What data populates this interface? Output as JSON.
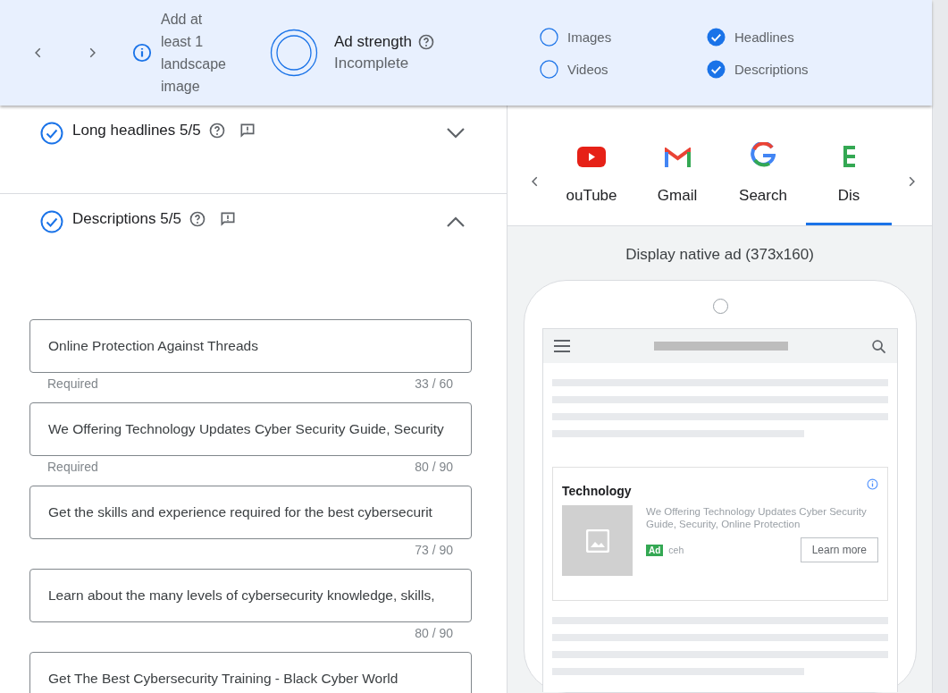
{
  "banner": {
    "tip": "Add at least 1 landscape image",
    "strength_label": "Ad strength",
    "strength_value": "Incomplete",
    "checklist": [
      {
        "label": "Images",
        "checked": false
      },
      {
        "label": "Videos",
        "checked": false
      },
      {
        "label": "Headlines",
        "checked": true
      },
      {
        "label": "Descriptions",
        "checked": true
      }
    ]
  },
  "sections": [
    {
      "title": "Long headlines 5/5",
      "complete": true,
      "expanded": false
    },
    {
      "title": "Descriptions 5/5",
      "complete": true,
      "expanded": true
    }
  ],
  "descriptions": [
    {
      "value": "Online Protection Against Threads",
      "helper": "Required",
      "count": "33 / 60"
    },
    {
      "value": "We Offering Technology Updates Cyber Security Guide, Security",
      "helper": "Required",
      "count": "80 / 90"
    },
    {
      "value": "Get the skills and experience required for the best cybersecurit",
      "count": "73 / 90"
    },
    {
      "value": "Learn about the many levels of cybersecurity knowledge, skills,",
      "count": "80 / 90"
    },
    {
      "value": "Get The Best Cybersecurity Training - Black Cyber World"
    }
  ],
  "preview": {
    "tabs": [
      {
        "label": "ouTube",
        "kind": "youtube",
        "selected": false
      },
      {
        "label": "Gmail",
        "kind": "gmail",
        "selected": false
      },
      {
        "label": "Search",
        "kind": "search",
        "selected": false
      },
      {
        "label": "Dis",
        "kind": "display",
        "selected": true
      }
    ],
    "format": "Display native ad (373x160)",
    "ad": {
      "title": "Technology",
      "text": "We Offering Technology Updates Cyber Security Guide, Security, Online Protection",
      "badge": "Ad",
      "advertiser": "ceh",
      "cta": "Learn more"
    }
  }
}
